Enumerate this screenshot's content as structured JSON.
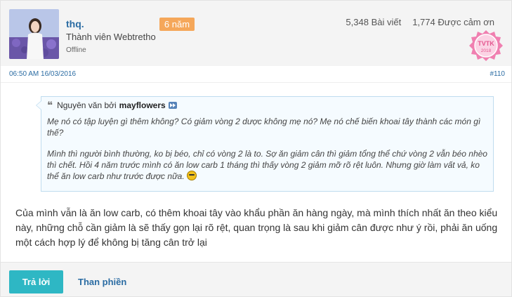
{
  "user": {
    "name": "thq.",
    "badge": "6 năm",
    "member_title": "Thành viên Webtretho",
    "status": "Offline",
    "posts": "5,348 Bài viết",
    "thanks": "1,774 Được cảm ơn",
    "award": {
      "label": "TVTK",
      "year": "2018",
      "color": "#f07fb0"
    }
  },
  "post": {
    "timestamp": "06:50 AM 16/03/2016",
    "number": "#110"
  },
  "quote": {
    "prefix": "Nguyên văn bởi",
    "author": "mayflowers",
    "question": "Mẹ nó có tập luyện gì thêm không? Có giảm vòng 2 dược không mẹ nó? Mẹ nó chế biến khoai tây thành các món gì thế?",
    "answer": "Mình thì người bình thường, ko bị béo, chỉ có vòng 2 là to. Sợ ăn giảm cân thì giảm tổng thể chứ vòng 2 vẫn béo nhèo thì chết. Hồi 4 năm trước mình có ăn low carb 1 tháng thì thấy vòng 2 giảm mỡ rõ rệt luôn. Nhưng giờ làm vất vả, ko thể ăn low carb như trước được nữa."
  },
  "message": "Của mình vẫn là ăn low carb, có thêm khoai tây vào khẩu phần ăn hàng ngày, mà mình thích nhất ăn theo kiểu này, những chỗ cần giảm là sẽ thấy gọn lại rõ rệt, quan trọng là sau khi giảm cân được như ý rồi, phải ăn uống một cách hợp lý để không bị tăng cân trở lại",
  "actions": {
    "reply": "Trả lời",
    "complain": "Than phiền"
  },
  "colors": {
    "accent": "#2eb7c4",
    "link": "#2b6ca3",
    "badge": "#f5a75a"
  }
}
